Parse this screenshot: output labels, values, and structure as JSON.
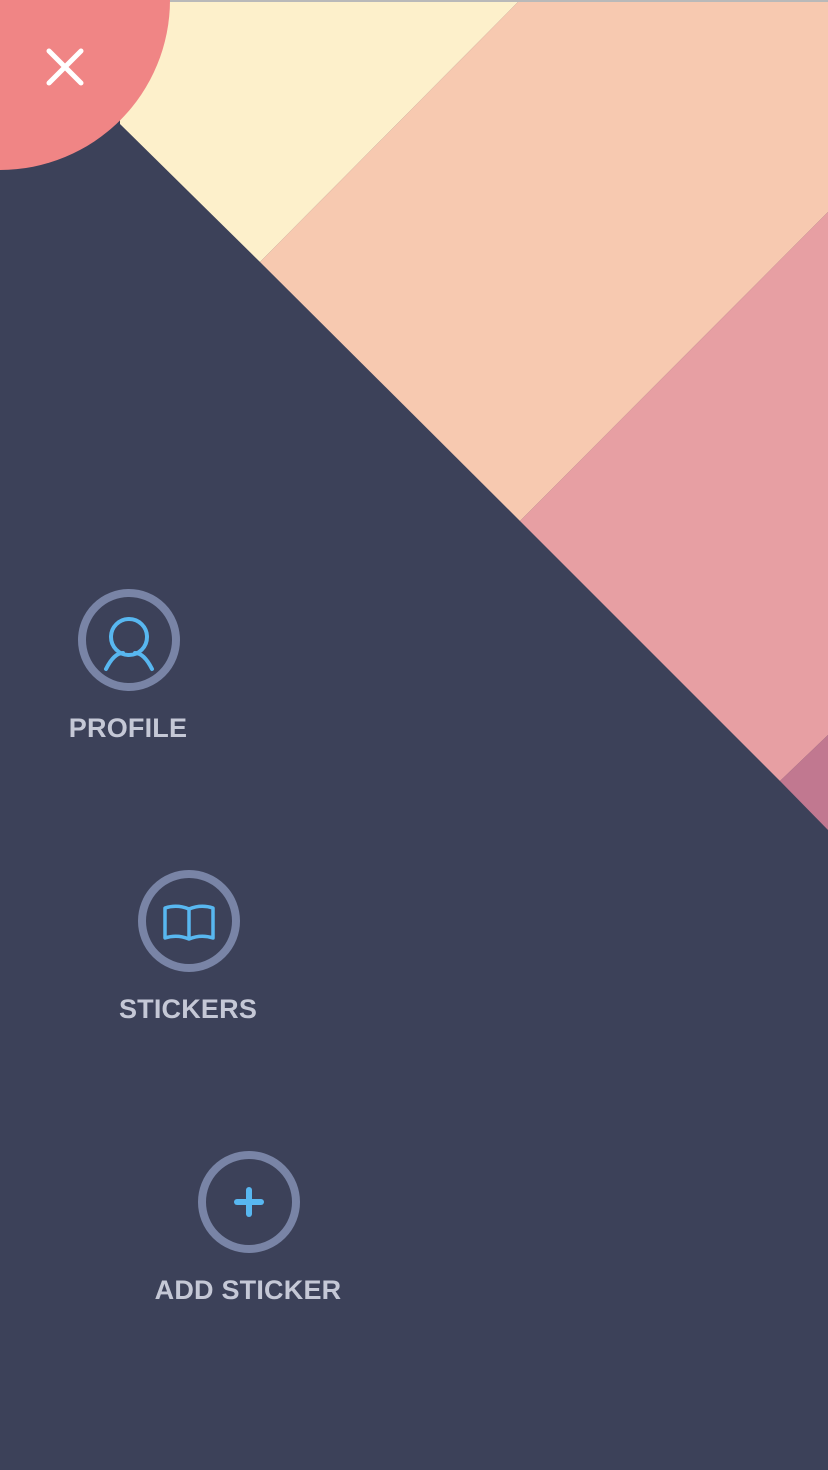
{
  "colors": {
    "background": "#3c4159",
    "close_circle": "#f08585",
    "cream_stripe": "#fdf0cb",
    "peach_stripe": "#f7c9b0",
    "pink_stripe": "#e79fa3",
    "mauve_stripe": "#c17890",
    "icon_ring": "#7984a6",
    "icon_glyph": "#58b7f0",
    "label_text": "#c5c8d6"
  },
  "close": {
    "icon": "close-icon"
  },
  "menu": {
    "items": [
      {
        "id": "profile",
        "label": "PROFILE",
        "icon": "user-icon"
      },
      {
        "id": "stickers",
        "label": "STICKERS",
        "icon": "book-icon"
      },
      {
        "id": "add-sticker",
        "label": "ADD STICKER",
        "icon": "plus-icon"
      }
    ]
  }
}
